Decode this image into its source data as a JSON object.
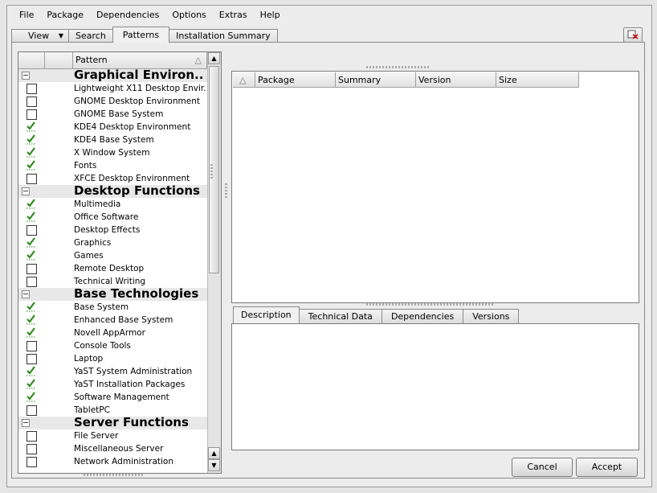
{
  "menu": [
    "File",
    "Package",
    "Dependencies",
    "Options",
    "Extras",
    "Help"
  ],
  "tabs": {
    "view": "View",
    "search": "Search",
    "patterns": "Patterns",
    "installation_summary": "Installation Summary"
  },
  "pattern_list": {
    "column_header": "Pattern",
    "groups": [
      {
        "title": "Graphical Environ...",
        "items": [
          {
            "label": "Lightweight X11 Desktop Envir...",
            "checked": false
          },
          {
            "label": "GNOME Desktop Environment",
            "checked": false
          },
          {
            "label": "GNOME Base System",
            "checked": false
          },
          {
            "label": "KDE4 Desktop Environment",
            "checked": true
          },
          {
            "label": "KDE4 Base System",
            "checked": true
          },
          {
            "label": "X Window System",
            "checked": true
          },
          {
            "label": "Fonts",
            "checked": true
          },
          {
            "label": "XFCE Desktop Environment",
            "checked": false
          }
        ]
      },
      {
        "title": "Desktop Functions",
        "items": [
          {
            "label": "Multimedia",
            "checked": true
          },
          {
            "label": "Office Software",
            "checked": true
          },
          {
            "label": "Desktop Effects",
            "checked": false
          },
          {
            "label": "Graphics",
            "checked": true
          },
          {
            "label": "Games",
            "checked": true
          },
          {
            "label": "Remote Desktop",
            "checked": false
          },
          {
            "label": "Technical Writing",
            "checked": false
          }
        ]
      },
      {
        "title": "Base Technologies",
        "items": [
          {
            "label": "Base System",
            "checked": true
          },
          {
            "label": "Enhanced Base System",
            "checked": true
          },
          {
            "label": "Novell AppArmor",
            "checked": true
          },
          {
            "label": "Console Tools",
            "checked": false
          },
          {
            "label": "Laptop",
            "checked": false
          },
          {
            "label": "YaST System Administration",
            "checked": true
          },
          {
            "label": "YaST Installation Packages",
            "checked": true
          },
          {
            "label": "Software Management",
            "checked": true
          },
          {
            "label": "TabletPC",
            "checked": false
          }
        ]
      },
      {
        "title": "Server Functions",
        "items": [
          {
            "label": "File Server",
            "checked": false
          },
          {
            "label": "Miscellaneous Server",
            "checked": false
          },
          {
            "label": "Network Administration",
            "checked": false
          }
        ]
      }
    ]
  },
  "package_table": {
    "columns": [
      "Package",
      "Summary",
      "Version",
      "Size"
    ]
  },
  "detail_tabs": [
    "Description",
    "Technical Data",
    "Dependencies",
    "Versions"
  ],
  "buttons": {
    "cancel": "Cancel",
    "accept": "Accept"
  },
  "colors": {
    "check": "#2f8a1f",
    "category_bg": "#e8e8e8"
  }
}
